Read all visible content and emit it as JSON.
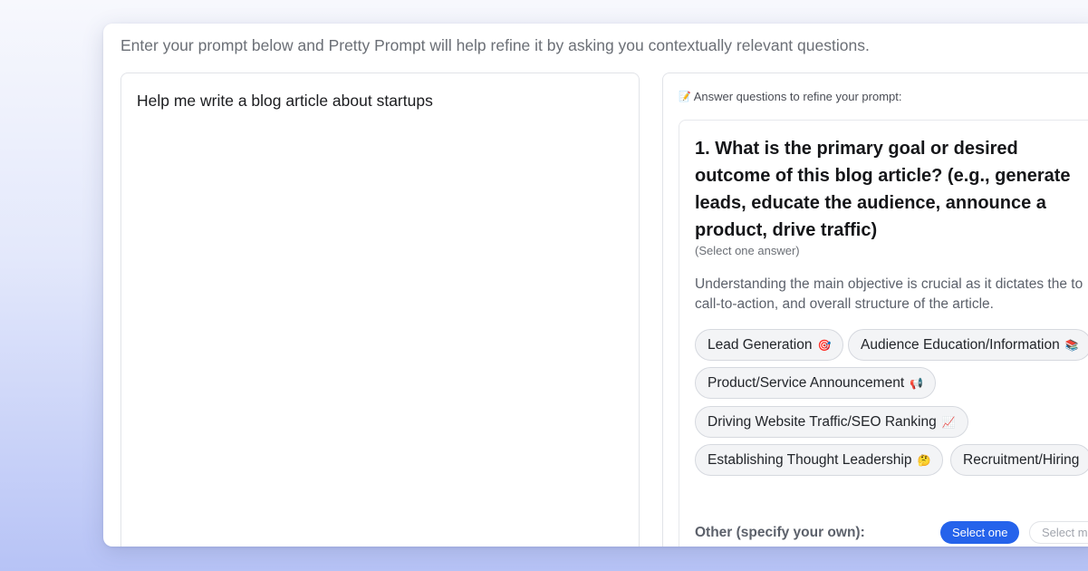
{
  "intro_text": "Enter your prompt below and Pretty Prompt will help refine it by asking you contextually relevant questions.",
  "prompt": {
    "value": "Help me write a blog article about startups"
  },
  "panel": {
    "header_icon": "📝",
    "header_label": "Answer questions to refine your prompt:"
  },
  "question": {
    "title": "1. What is the primary goal or desired outcome of this blog article? (e.g., generate leads, educate the audience, announce a product, drive traffic)",
    "subtitle": "(Select one answer)",
    "description_line1": "Understanding the main objective is crucial as it dictates the to",
    "description_line2": "call-to-action, and overall structure of the article.",
    "options": [
      {
        "label": "Lead Generation",
        "emoji": "🎯"
      },
      {
        "label": "Audience Education/Information",
        "emoji": "📚"
      },
      {
        "label": "Product/Service Announcement",
        "emoji": "📢"
      },
      {
        "label": "Driving Website Traffic/SEO Ranking",
        "emoji": "📈"
      },
      {
        "label": "Establishing Thought Leadership",
        "emoji": "🤔"
      },
      {
        "label": "Recruitment/Hiring",
        "emoji": ""
      }
    ],
    "other_label": "Other (specify your own):",
    "select_one_label": "Select one",
    "select_many_label": "Select m"
  }
}
